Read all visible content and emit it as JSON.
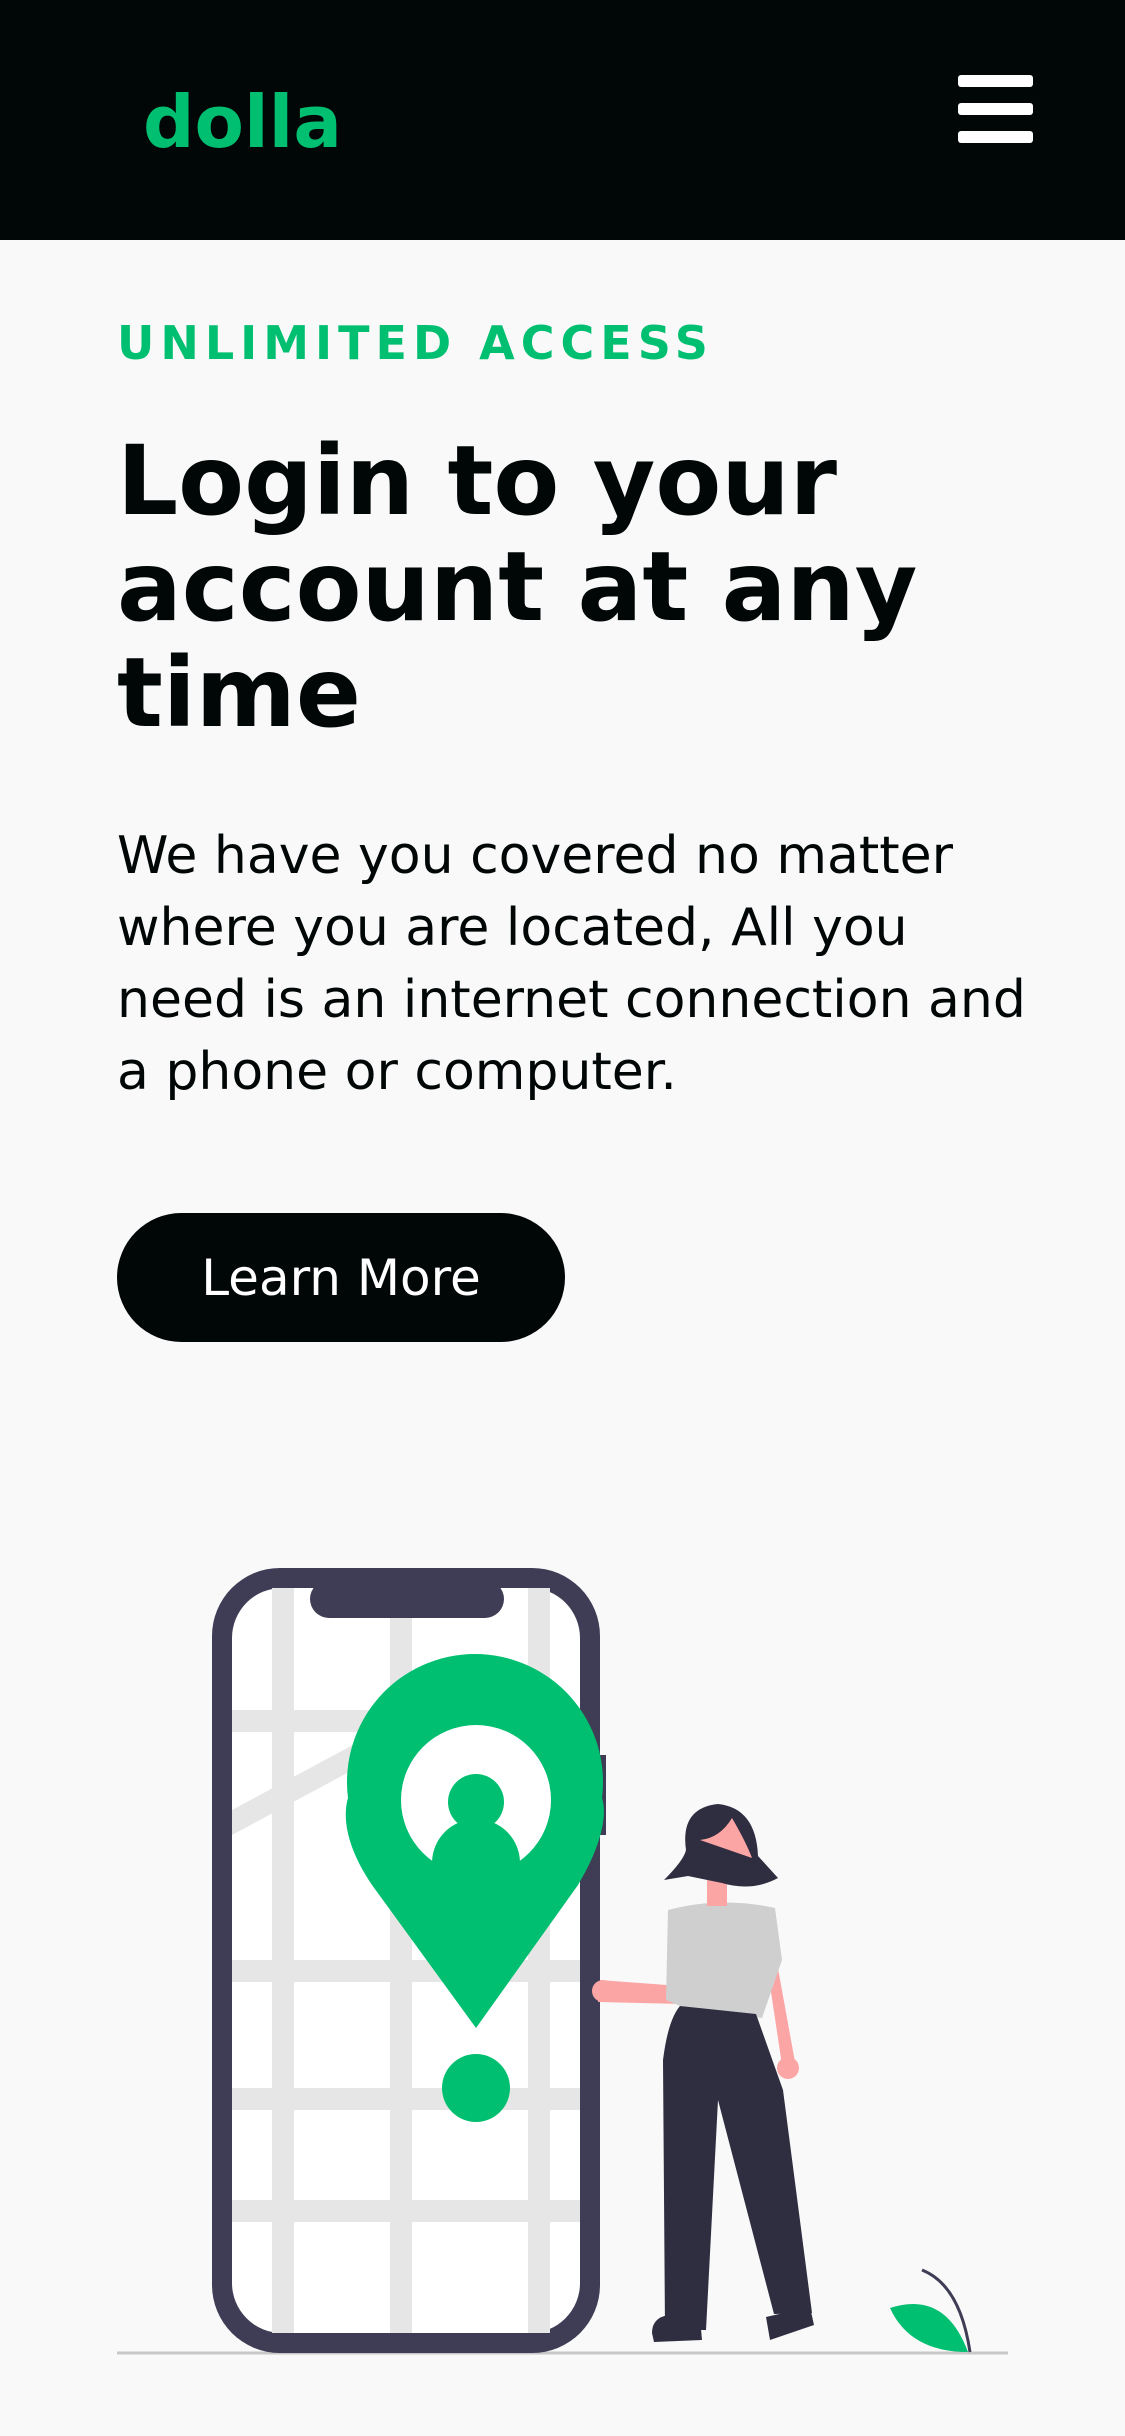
{
  "nav": {
    "logo": "dolla",
    "menu_icon": "hamburger-menu-icon"
  },
  "hero": {
    "topline": "UNLIMITED ACCESS",
    "heading": "Login to your account at any time",
    "subtitle": "We have you covered no matter where you are located, All you need is an internet connection and a phone or computer.",
    "button_label": "Learn More"
  },
  "colors": {
    "brand_green": "#01bf71",
    "nav_background": "#010606",
    "page_background": "#f9f9f9",
    "phone_frame": "#3f3d56"
  },
  "illustration": {
    "name": "woman-with-phone-map-location-illustration",
    "icons": [
      "location-pin-icon",
      "leaf-icon"
    ]
  }
}
